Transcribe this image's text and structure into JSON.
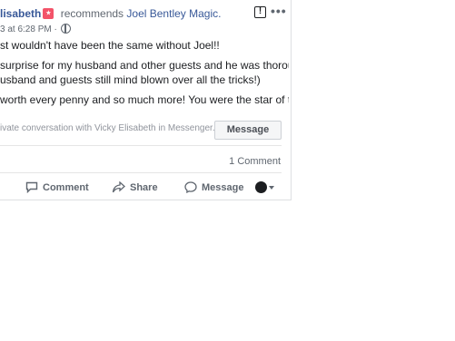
{
  "post": {
    "author_name": "lisabeth",
    "action_text": "recommends",
    "page_name": "Joel Bentley Magic.",
    "timestamp": "3 at 6:28 PM ·",
    "body": [
      "st wouldn't have been the same without Joel!!",
      "surprise for my husband and other guests and he was thoroughly",
      "usband and guests still mind blown over all the tricks!)",
      "worth every penny and so much more! You were the star of the"
    ],
    "private_text": "ivate conversation with Vicky Elisabeth in Messenger.",
    "message_button": "Message",
    "comment_count": "1 Comment"
  },
  "actions": {
    "comment": "Comment",
    "share": "Share",
    "message": "Message"
  },
  "icons": [
    "recommend-badge-icon",
    "globe-icon",
    "flag-icon",
    "more-dots-icon",
    "comment-icon",
    "share-icon",
    "messenger-icon",
    "avatar",
    "caret-down-icon"
  ],
  "colors": {
    "link": "#385898",
    "recommend_badge": "#f35369",
    "muted": "#606770"
  }
}
